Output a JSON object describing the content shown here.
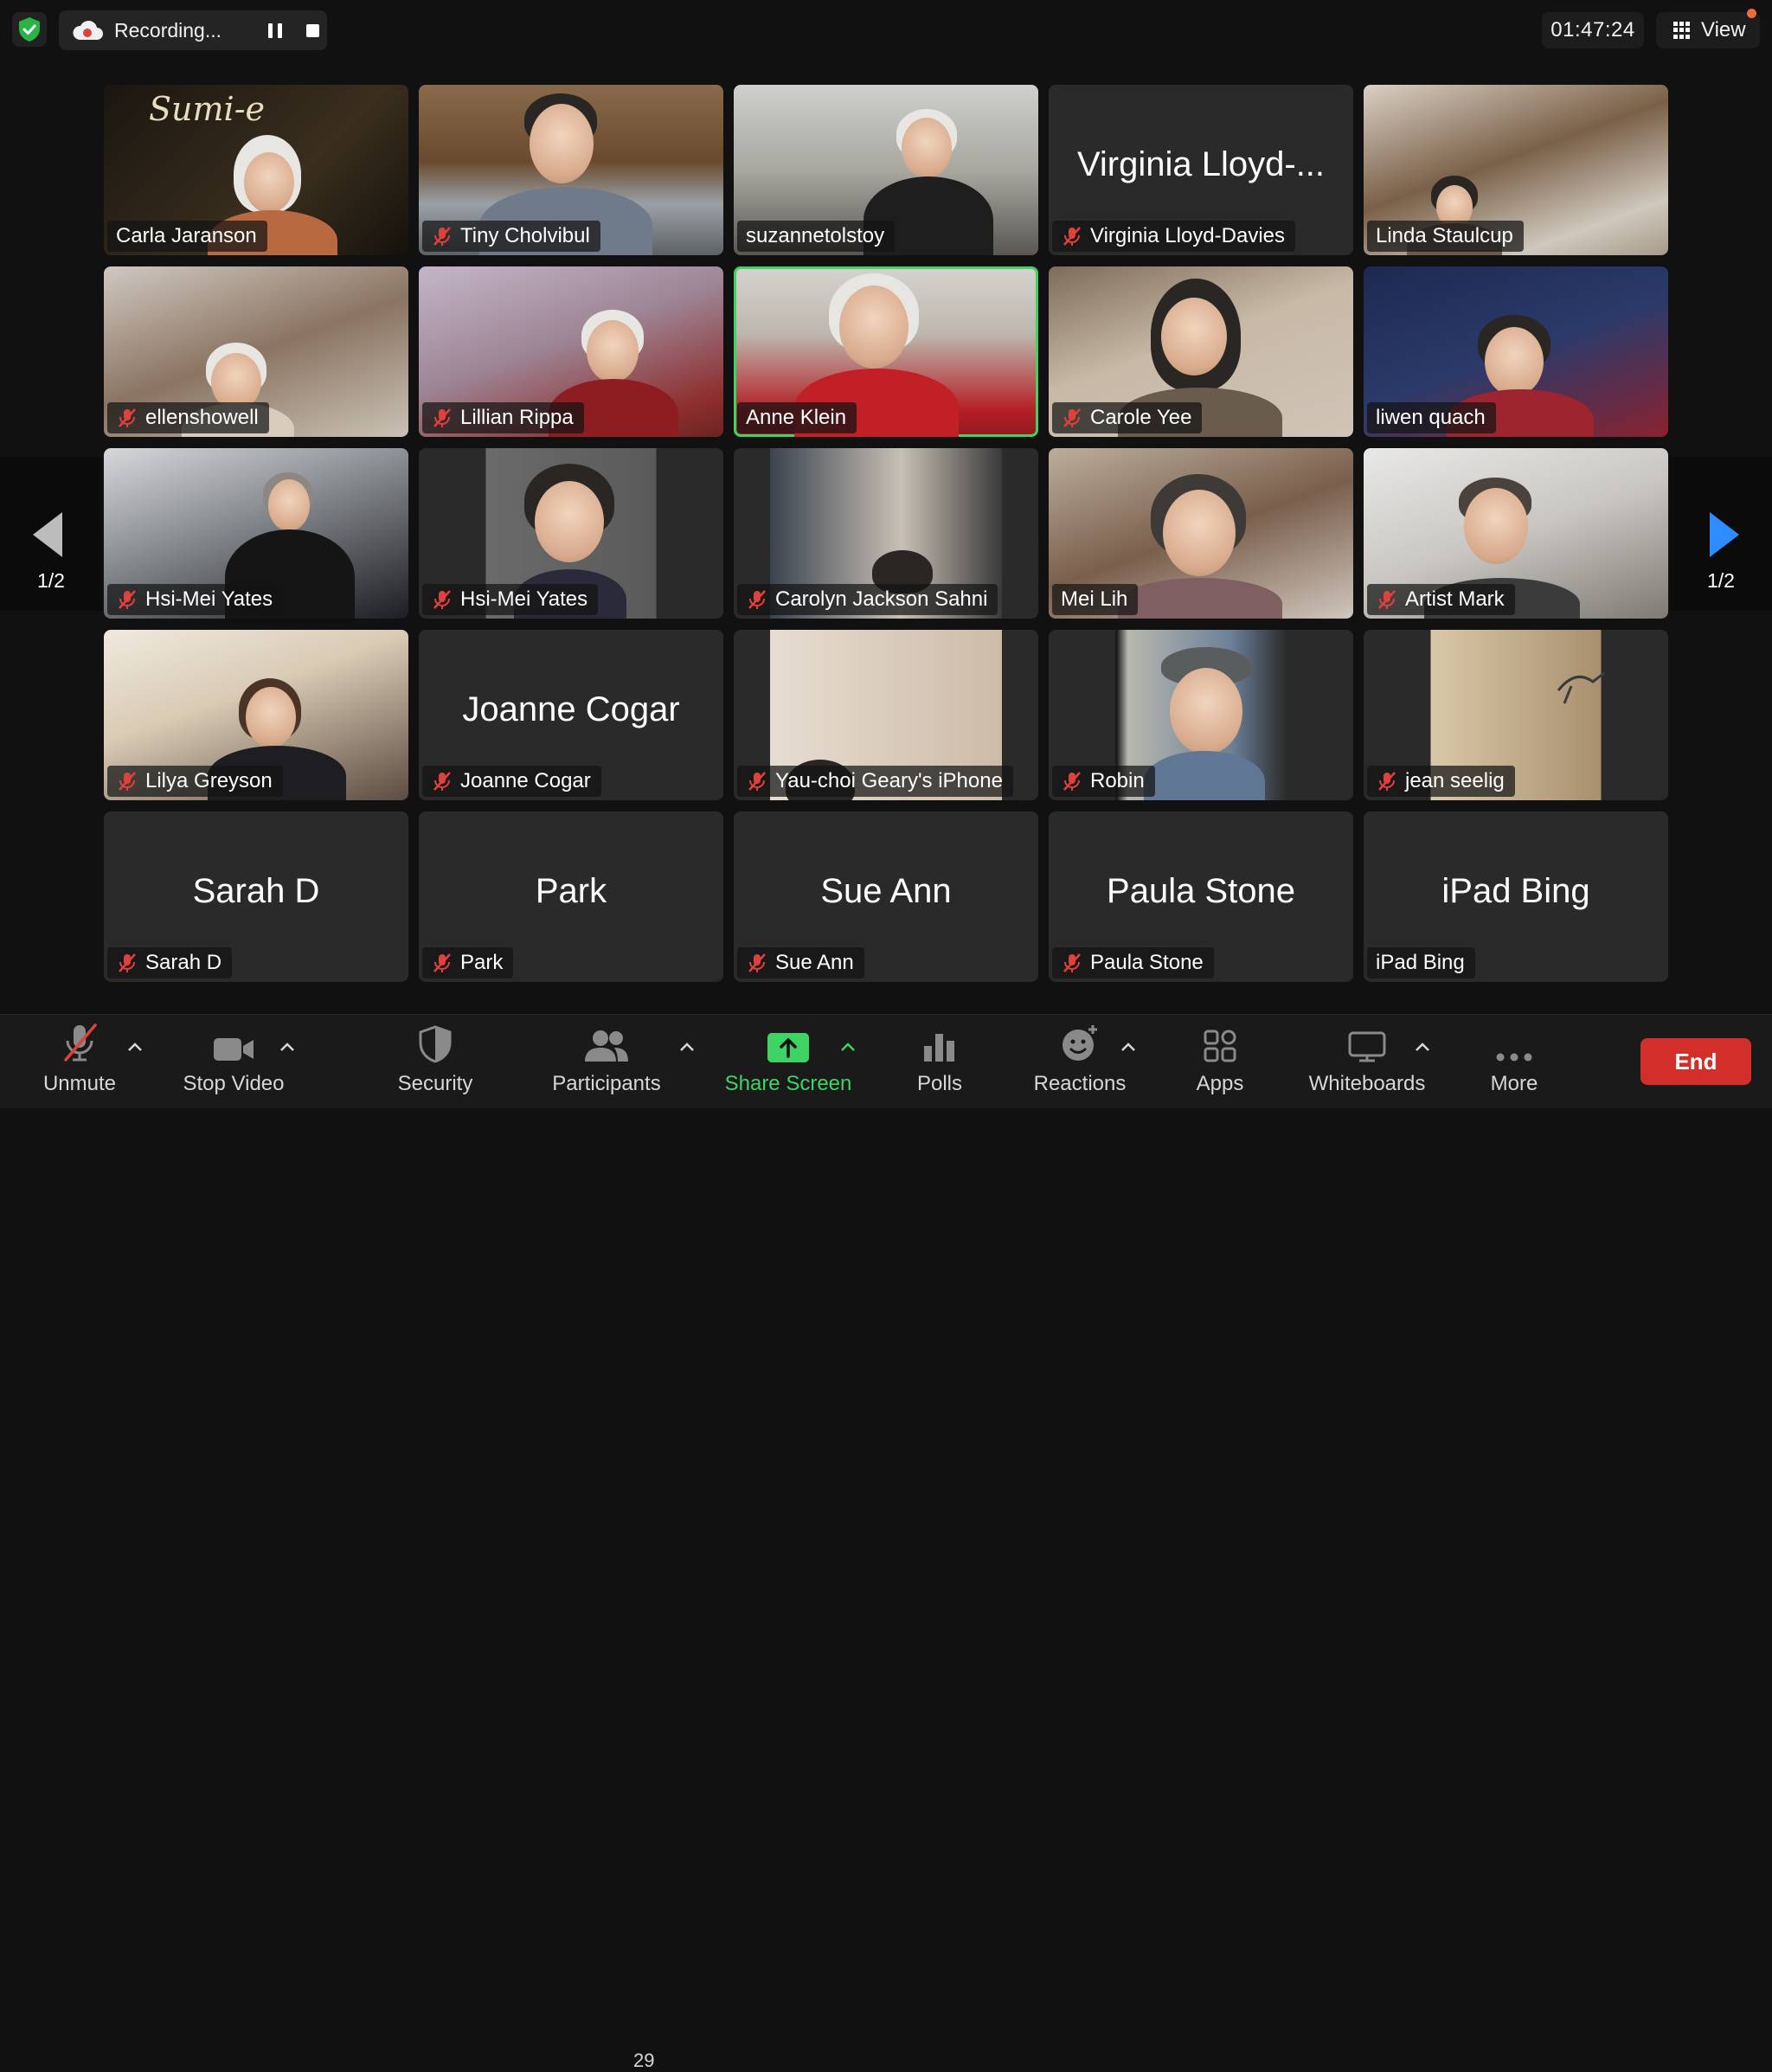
{
  "recording": {
    "label": "Recording..."
  },
  "timer": "01:47:24",
  "view": {
    "label": "View"
  },
  "pager": {
    "left": "1/2",
    "right": "1/2"
  },
  "participants": [
    {
      "name": "Carla Jaranson",
      "muted": false,
      "video": true,
      "active": false
    },
    {
      "name": "Tiny Cholvibul",
      "muted": true,
      "video": true,
      "active": false
    },
    {
      "name": "suzannetolstoy",
      "muted": false,
      "video": true,
      "active": false
    },
    {
      "name": "Virginia Lloyd-Davies",
      "display": "Virginia Lloyd-...",
      "muted": true,
      "video": false,
      "active": false
    },
    {
      "name": "Linda Staulcup",
      "muted": false,
      "video": true,
      "active": false
    },
    {
      "name": "ellenshowell",
      "muted": true,
      "video": true,
      "active": false
    },
    {
      "name": "Lillian Rippa",
      "muted": true,
      "video": true,
      "active": false
    },
    {
      "name": "Anne Klein",
      "muted": false,
      "video": true,
      "active": true
    },
    {
      "name": "Carole Yee",
      "muted": true,
      "video": true,
      "active": false
    },
    {
      "name": "liwen quach",
      "muted": false,
      "video": true,
      "active": false
    },
    {
      "name": "Hsi-Mei Yates",
      "muted": true,
      "video": true,
      "active": false
    },
    {
      "name": "Hsi-Mei Yates",
      "muted": true,
      "video": true,
      "active": false
    },
    {
      "name": "Carolyn Jackson Sahni",
      "muted": true,
      "video": true,
      "active": false
    },
    {
      "name": "Mei Lih",
      "muted": false,
      "video": true,
      "active": false
    },
    {
      "name": "Artist Mark",
      "muted": true,
      "video": true,
      "active": false
    },
    {
      "name": "Lilya Greyson",
      "muted": true,
      "video": true,
      "active": false
    },
    {
      "name": "Joanne Cogar",
      "display": "Joanne Cogar",
      "muted": true,
      "video": false,
      "active": false
    },
    {
      "name": "Yau-choi Geary's iPhone",
      "muted": true,
      "video": true,
      "active": false
    },
    {
      "name": "Robin",
      "muted": true,
      "video": true,
      "active": false
    },
    {
      "name": "jean seelig",
      "muted": true,
      "video": true,
      "active": false
    },
    {
      "name": "Sarah D",
      "display": "Sarah D",
      "muted": true,
      "video": false,
      "active": false
    },
    {
      "name": "Park",
      "display": "Park",
      "muted": true,
      "video": false,
      "active": false
    },
    {
      "name": "Sue Ann",
      "display": "Sue Ann",
      "muted": true,
      "video": false,
      "active": false
    },
    {
      "name": "Paula Stone",
      "display": "Paula Stone",
      "muted": true,
      "video": false,
      "active": false
    },
    {
      "name": "iPad Bing",
      "display": "iPad Bing",
      "muted": false,
      "video": false,
      "active": false
    }
  ],
  "tile_extras": {
    "sumie_text": "Sumi-e"
  },
  "toolbar": {
    "unmute": "Unmute",
    "stop_video": "Stop Video",
    "security": "Security",
    "participants": "Participants",
    "participants_count": "29",
    "share_screen": "Share Screen",
    "polls": "Polls",
    "reactions": "Reactions",
    "apps": "Apps",
    "whiteboards": "Whiteboards",
    "more": "More",
    "end": "End"
  },
  "colors": {
    "accent_green": "#3fd265",
    "end_red": "#d22f2a",
    "muted_red": "#e0413b",
    "arrow_blue": "#2d8cff"
  }
}
